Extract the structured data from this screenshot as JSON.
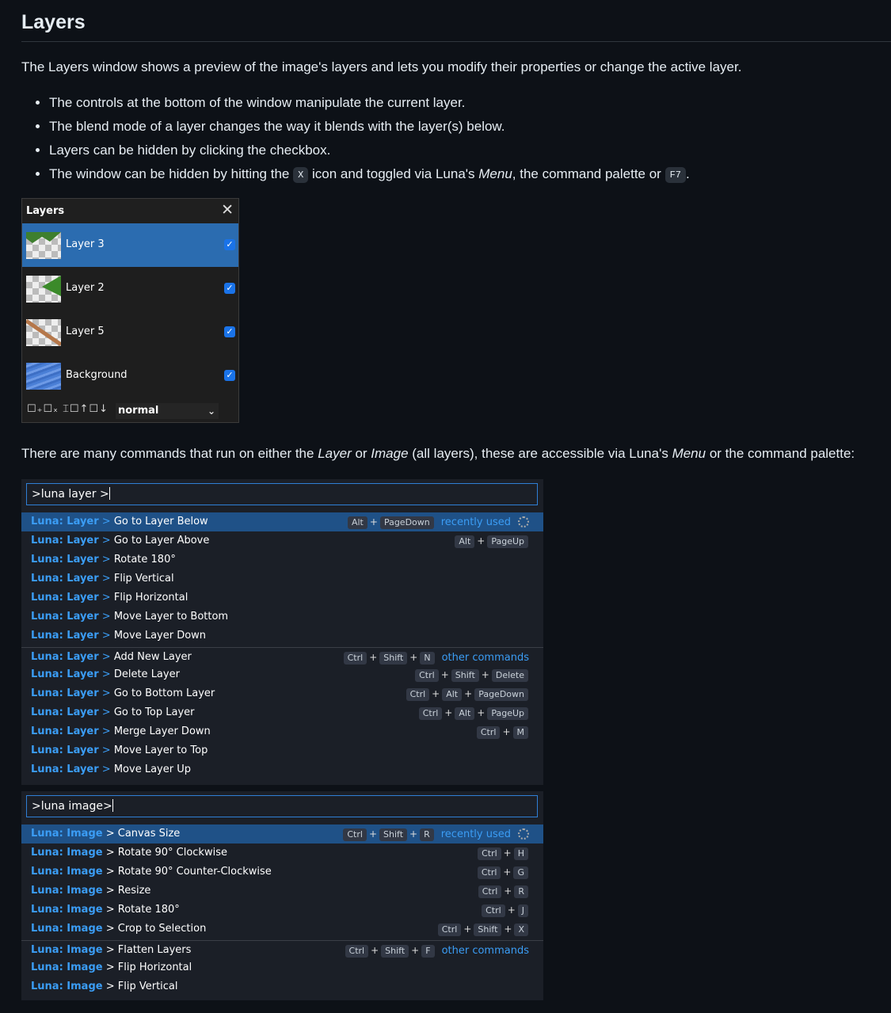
{
  "heading": "Layers",
  "intro": "The Layers window shows a preview of the image's layers and lets you modify their properties or change the active layer.",
  "bullets": {
    "b1": "The controls at the bottom of the window manipulate the current layer.",
    "b2": "The blend mode of a layer changes the way it blends with the layer(s) below.",
    "b3": "Layers can be hidden by clicking the checkbox.",
    "b4_a": "The window can be hidden by hitting the ",
    "b4_key1": "X",
    "b4_b": " icon and toggled via Luna's ",
    "b4_menu": "Menu",
    "b4_c": ", the command palette or ",
    "b4_key2": "F7",
    "b4_d": "."
  },
  "layers_window": {
    "title": "Layers",
    "close": "✕",
    "layers": [
      {
        "name": "Layer 3",
        "checked": true,
        "selected": true
      },
      {
        "name": "Layer 2",
        "checked": true,
        "selected": false
      },
      {
        "name": "Layer 5",
        "checked": true,
        "selected": false
      },
      {
        "name": "Background",
        "checked": true,
        "selected": false
      }
    ],
    "check_mark": "✓",
    "tools": "☐₊☐ₓ ⌶☐↑☐↓",
    "blend_mode": "normal",
    "caret": "⌄"
  },
  "para2": {
    "a": "There are many commands that run on either the ",
    "layer": "Layer",
    "b": " or ",
    "image": "Image",
    "c": " (all layers), these are accessible via Luna's ",
    "menu": "Menu",
    "d": " or the command palette:"
  },
  "palette1": {
    "query": ">luna layer >",
    "prefix": "Luna: Layer",
    "sep": ">",
    "items": [
      {
        "cmd": "Go to Layer Below",
        "keys": [
          "Alt",
          "PageDown"
        ],
        "tag": "recently used",
        "gear": true
      },
      {
        "cmd": "Go to Layer Above",
        "keys": [
          "Alt",
          "PageUp"
        ]
      },
      {
        "cmd": "Rotate 180°",
        "keys": []
      },
      {
        "cmd": "Flip Vertical",
        "keys": []
      },
      {
        "cmd": "Flip Horizontal",
        "keys": []
      },
      {
        "cmd": "Move Layer to Bottom",
        "keys": []
      },
      {
        "cmd": "Move Layer Down",
        "keys": []
      },
      {
        "cmd": "Add New Layer",
        "keys": [
          "Ctrl",
          "Shift",
          "N"
        ],
        "tag": "other commands"
      },
      {
        "cmd": "Delete Layer",
        "keys": [
          "Ctrl",
          "Shift",
          "Delete"
        ]
      },
      {
        "cmd": "Go to Bottom Layer",
        "keys": [
          "Ctrl",
          "Alt",
          "PageDown"
        ]
      },
      {
        "cmd": "Go to Top Layer",
        "keys": [
          "Ctrl",
          "Alt",
          "PageUp"
        ]
      },
      {
        "cmd": "Merge Layer Down",
        "keys": [
          "Ctrl",
          "M"
        ]
      },
      {
        "cmd": "Move Layer to Top",
        "keys": []
      },
      {
        "cmd": "Move Layer Up",
        "keys": []
      }
    ]
  },
  "palette2": {
    "query": ">luna image>",
    "prefix": "Luna: Image",
    "sep": ">",
    "items": [
      {
        "cmd": "Canvas Size",
        "keys": [
          "Ctrl",
          "Shift",
          "R"
        ],
        "tag": "recently used",
        "gear": true
      },
      {
        "cmd": "Rotate 90° Clockwise",
        "keys": [
          "Ctrl",
          "H"
        ]
      },
      {
        "cmd": "Rotate 90° Counter-Clockwise",
        "keys": [
          "Ctrl",
          "G"
        ]
      },
      {
        "cmd": "Resize",
        "keys": [
          "Ctrl",
          "R"
        ]
      },
      {
        "cmd": "Rotate 180°",
        "keys": [
          "Ctrl",
          "J"
        ]
      },
      {
        "cmd": "Crop to Selection",
        "keys": [
          "Ctrl",
          "Shift",
          "X"
        ]
      },
      {
        "cmd": "Flatten Layers",
        "keys": [
          "Ctrl",
          "Shift",
          "F"
        ],
        "tag": "other commands"
      },
      {
        "cmd": "Flip Horizontal",
        "keys": []
      },
      {
        "cmd": "Flip Vertical",
        "keys": []
      }
    ]
  },
  "colors": {
    "accent": "#3b9df5",
    "selection": "#1f5187",
    "layer_selection": "#2b6cb0"
  }
}
